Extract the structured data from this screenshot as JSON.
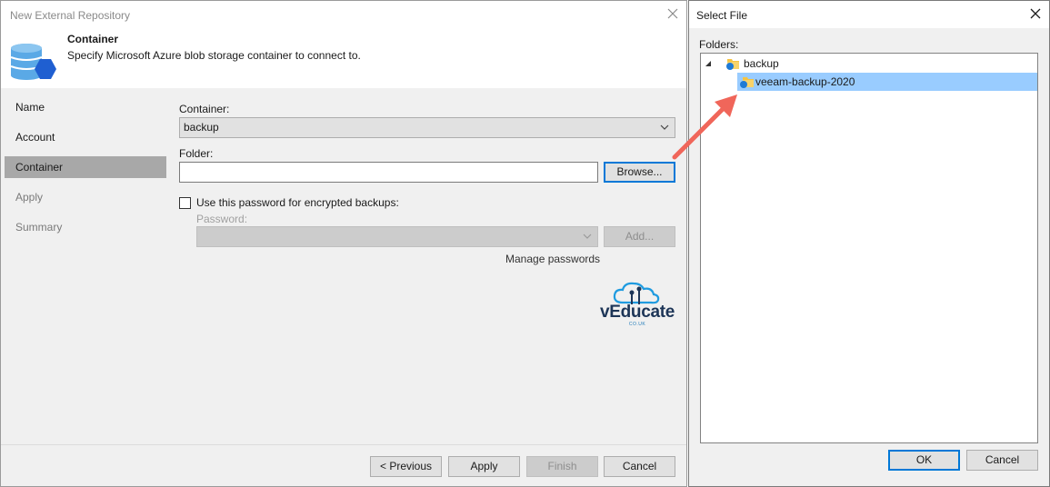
{
  "wizard": {
    "title": "New External Repository",
    "header": {
      "title": "Container",
      "subtitle": "Specify Microsoft Azure blob storage container to connect to."
    },
    "nav": [
      {
        "label": "Name",
        "state": "normal"
      },
      {
        "label": "Account",
        "state": "normal"
      },
      {
        "label": "Container",
        "state": "active"
      },
      {
        "label": "Apply",
        "state": "disabled"
      },
      {
        "label": "Summary",
        "state": "disabled"
      }
    ],
    "form": {
      "container_label": "Container:",
      "container_value": "backup",
      "folder_label": "Folder:",
      "folder_value": "",
      "browse_label": "Browse...",
      "encrypt_label": "Use this password for encrypted backups:",
      "encrypt_checked": false,
      "password_label": "Password:",
      "password_value": "",
      "add_label": "Add...",
      "manage_passwords": "Manage passwords"
    },
    "logo": {
      "text": "vEducate",
      "subtext": "CO.UK"
    },
    "footer": {
      "previous": "< Previous",
      "apply": "Apply",
      "finish": "Finish",
      "cancel": "Cancel"
    }
  },
  "dialog": {
    "title": "Select File",
    "folders_label": "Folders:",
    "tree": [
      {
        "label": "backup",
        "expanded": true
      },
      {
        "label": "veeam-backup-2020",
        "selected": true
      }
    ],
    "ok": "OK",
    "cancel": "Cancel"
  },
  "colors": {
    "accent": "#0078d7",
    "selection": "#99ccff",
    "arrow": "#f0665a",
    "folder": "#f5c342",
    "storage_blue": "#1f7ad6"
  }
}
